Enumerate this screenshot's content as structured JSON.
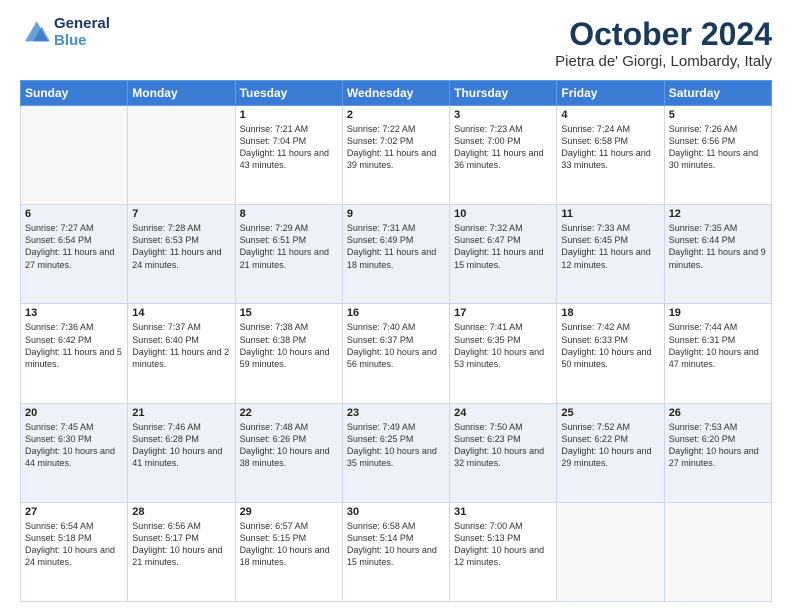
{
  "header": {
    "logo_line1": "General",
    "logo_line2": "Blue",
    "month": "October 2024",
    "location": "Pietra de' Giorgi, Lombardy, Italy"
  },
  "weekdays": [
    "Sunday",
    "Monday",
    "Tuesday",
    "Wednesday",
    "Thursday",
    "Friday",
    "Saturday"
  ],
  "weeks": [
    [
      {
        "day": "",
        "info": ""
      },
      {
        "day": "",
        "info": ""
      },
      {
        "day": "1",
        "info": "Sunrise: 7:21 AM\nSunset: 7:04 PM\nDaylight: 11 hours and 43 minutes."
      },
      {
        "day": "2",
        "info": "Sunrise: 7:22 AM\nSunset: 7:02 PM\nDaylight: 11 hours and 39 minutes."
      },
      {
        "day": "3",
        "info": "Sunrise: 7:23 AM\nSunset: 7:00 PM\nDaylight: 11 hours and 36 minutes."
      },
      {
        "day": "4",
        "info": "Sunrise: 7:24 AM\nSunset: 6:58 PM\nDaylight: 11 hours and 33 minutes."
      },
      {
        "day": "5",
        "info": "Sunrise: 7:26 AM\nSunset: 6:56 PM\nDaylight: 11 hours and 30 minutes."
      }
    ],
    [
      {
        "day": "6",
        "info": "Sunrise: 7:27 AM\nSunset: 6:54 PM\nDaylight: 11 hours and 27 minutes."
      },
      {
        "day": "7",
        "info": "Sunrise: 7:28 AM\nSunset: 6:53 PM\nDaylight: 11 hours and 24 minutes."
      },
      {
        "day": "8",
        "info": "Sunrise: 7:29 AM\nSunset: 6:51 PM\nDaylight: 11 hours and 21 minutes."
      },
      {
        "day": "9",
        "info": "Sunrise: 7:31 AM\nSunset: 6:49 PM\nDaylight: 11 hours and 18 minutes."
      },
      {
        "day": "10",
        "info": "Sunrise: 7:32 AM\nSunset: 6:47 PM\nDaylight: 11 hours and 15 minutes."
      },
      {
        "day": "11",
        "info": "Sunrise: 7:33 AM\nSunset: 6:45 PM\nDaylight: 11 hours and 12 minutes."
      },
      {
        "day": "12",
        "info": "Sunrise: 7:35 AM\nSunset: 6:44 PM\nDaylight: 11 hours and 9 minutes."
      }
    ],
    [
      {
        "day": "13",
        "info": "Sunrise: 7:36 AM\nSunset: 6:42 PM\nDaylight: 11 hours and 5 minutes."
      },
      {
        "day": "14",
        "info": "Sunrise: 7:37 AM\nSunset: 6:40 PM\nDaylight: 11 hours and 2 minutes."
      },
      {
        "day": "15",
        "info": "Sunrise: 7:38 AM\nSunset: 6:38 PM\nDaylight: 10 hours and 59 minutes."
      },
      {
        "day": "16",
        "info": "Sunrise: 7:40 AM\nSunset: 6:37 PM\nDaylight: 10 hours and 56 minutes."
      },
      {
        "day": "17",
        "info": "Sunrise: 7:41 AM\nSunset: 6:35 PM\nDaylight: 10 hours and 53 minutes."
      },
      {
        "day": "18",
        "info": "Sunrise: 7:42 AM\nSunset: 6:33 PM\nDaylight: 10 hours and 50 minutes."
      },
      {
        "day": "19",
        "info": "Sunrise: 7:44 AM\nSunset: 6:31 PM\nDaylight: 10 hours and 47 minutes."
      }
    ],
    [
      {
        "day": "20",
        "info": "Sunrise: 7:45 AM\nSunset: 6:30 PM\nDaylight: 10 hours and 44 minutes."
      },
      {
        "day": "21",
        "info": "Sunrise: 7:46 AM\nSunset: 6:28 PM\nDaylight: 10 hours and 41 minutes."
      },
      {
        "day": "22",
        "info": "Sunrise: 7:48 AM\nSunset: 6:26 PM\nDaylight: 10 hours and 38 minutes."
      },
      {
        "day": "23",
        "info": "Sunrise: 7:49 AM\nSunset: 6:25 PM\nDaylight: 10 hours and 35 minutes."
      },
      {
        "day": "24",
        "info": "Sunrise: 7:50 AM\nSunset: 6:23 PM\nDaylight: 10 hours and 32 minutes."
      },
      {
        "day": "25",
        "info": "Sunrise: 7:52 AM\nSunset: 6:22 PM\nDaylight: 10 hours and 29 minutes."
      },
      {
        "day": "26",
        "info": "Sunrise: 7:53 AM\nSunset: 6:20 PM\nDaylight: 10 hours and 27 minutes."
      }
    ],
    [
      {
        "day": "27",
        "info": "Sunrise: 6:54 AM\nSunset: 5:18 PM\nDaylight: 10 hours and 24 minutes."
      },
      {
        "day": "28",
        "info": "Sunrise: 6:56 AM\nSunset: 5:17 PM\nDaylight: 10 hours and 21 minutes."
      },
      {
        "day": "29",
        "info": "Sunrise: 6:57 AM\nSunset: 5:15 PM\nDaylight: 10 hours and 18 minutes."
      },
      {
        "day": "30",
        "info": "Sunrise: 6:58 AM\nSunset: 5:14 PM\nDaylight: 10 hours and 15 minutes."
      },
      {
        "day": "31",
        "info": "Sunrise: 7:00 AM\nSunset: 5:13 PM\nDaylight: 10 hours and 12 minutes."
      },
      {
        "day": "",
        "info": ""
      },
      {
        "day": "",
        "info": ""
      }
    ]
  ]
}
